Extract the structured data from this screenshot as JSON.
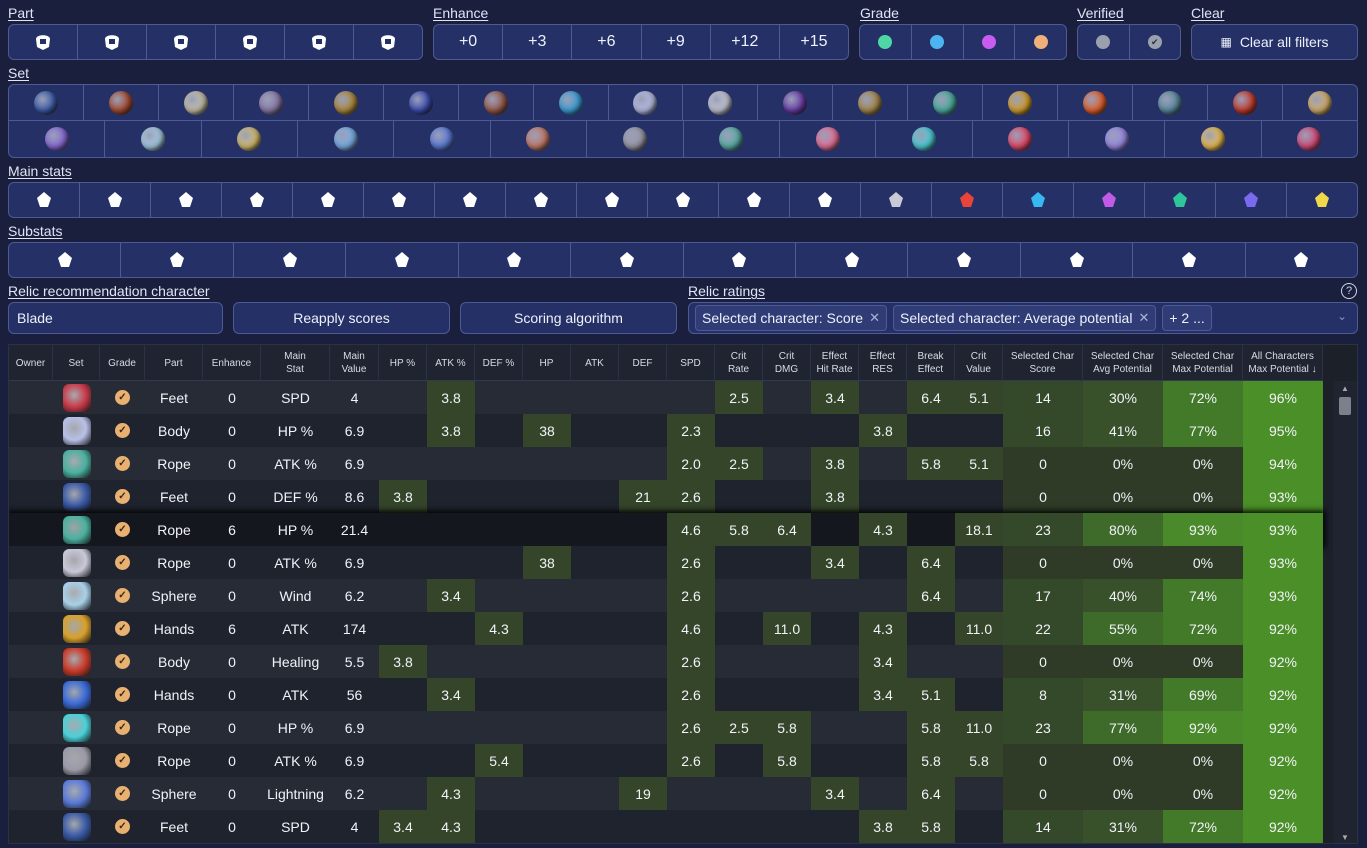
{
  "labels": {
    "part": "Part",
    "enhance": "Enhance",
    "grade": "Grade",
    "verified": "Verified",
    "clear": "Clear",
    "set": "Set",
    "main_stats": "Main stats",
    "substats": "Substats",
    "recommendation": "Relic recommendation character",
    "ratings": "Relic ratings"
  },
  "part_icons": [
    "helmet-icon",
    "gloves-icon",
    "body-armor-icon",
    "boots-icon",
    "orb-ring-icon",
    "rope-icon"
  ],
  "enhance_options": [
    "+0",
    "+3",
    "+6",
    "+9",
    "+12",
    "+15"
  ],
  "grade_colors": [
    "#4fd6a6",
    "#4cb4f0",
    "#c95cf0",
    "#f0b07a"
  ],
  "verified_colors": [
    "#9aa0ad",
    "#9aa0ad"
  ],
  "clear_label": "Clear all filters",
  "set_row1_colors": [
    "#3a5aa8",
    "#a84a2e",
    "#c9c2a8",
    "#8a7aa8",
    "#b08a3a",
    "#3a4ab0",
    "#9a5a4a",
    "#3aa0d8",
    "#b8c0e8",
    "#c8c8d8",
    "#6a3aa8",
    "#a88a4a",
    "#4ab0a0",
    "#d8a02a",
    "#e8602a",
    "#5a8aa0",
    "#c83a2a",
    "#d8b06a"
  ],
  "set_row2_colors": [
    "#8a6ad8",
    "#a8d0e8",
    "#d8c070",
    "#7ab0e8",
    "#5a7ad8",
    "#c87a6a",
    "#9a9aa8",
    "#5ab0a8",
    "#e8709a",
    "#4ad0d8",
    "#e84a6a",
    "#9a8ae8",
    "#f0c050",
    "#d84a7a"
  ],
  "main_stat_icons": [
    "hp-pct-icon",
    "atk-pct-icon",
    "def-pct-icon",
    "hp-icon",
    "atk-icon",
    "crit-rate-icon",
    "crit-dmg-icon",
    "outgoing-healing-icon",
    "effect-hit-icon",
    "spd-icon",
    "healing-icon",
    "break-effect-icon",
    "energy-regen-icon",
    "fire-icon",
    "ice-icon",
    "lightning-icon",
    "wind-icon",
    "quantum-icon",
    "imaginary-icon"
  ],
  "main_stat_colors": [
    "#fff",
    "#fff",
    "#fff",
    "#fff",
    "#fff",
    "#fff",
    "#fff",
    "#fff",
    "#fff",
    "#fff",
    "#fff",
    "#fff",
    "#c8cbd6",
    "#e8443a",
    "#38b8f0",
    "#c25ae8",
    "#2fc49a",
    "#7a6af0",
    "#f0d84a"
  ],
  "substat_icons": [
    "hp-pct-icon",
    "atk-pct-icon",
    "def-pct-icon",
    "hp-icon",
    "atk-icon",
    "def-icon",
    "crit-rate-icon",
    "crit-dmg-icon",
    "effect-hit-icon",
    "effect-res-icon",
    "break-effect-icon",
    "spd-icon"
  ],
  "character": "Blade",
  "reapply_label": "Reapply scores",
  "scoring_label": "Scoring algorithm",
  "rating_chips": [
    "Selected character: Score",
    "Selected character: Average potential"
  ],
  "rating_more": "+ 2 ...",
  "help_glyph": "?",
  "columns": [
    "Owner",
    "Set",
    "Grade",
    "Part",
    "Enhance",
    "Main\nStat",
    "Main\nValue",
    "HP %",
    "ATK %",
    "DEF %",
    "HP",
    "ATK",
    "DEF",
    "SPD",
    "Crit\nRate",
    "Crit\nDMG",
    "Effect\nHit Rate",
    "Effect\nRES",
    "Break\nEffect",
    "Crit\nValue",
    "Selected Char\nScore",
    "Selected Char\nAvg Potential",
    "Selected Char\nMax Potential",
    "All Characters\nMax Potential ↓"
  ],
  "rows": [
    {
      "set": "#c83a4a",
      "part": "Feet",
      "enh": "0",
      "ms": "SPD",
      "mv": "4",
      "s": [
        "",
        "3.8",
        "",
        "",
        "",
        "",
        "",
        "2.5",
        "",
        "3.4",
        "",
        "6.4"
      ],
      "cv": "5.1",
      "sc": "14",
      "avg": "30%",
      "max": "72%",
      "all": "96%"
    },
    {
      "set": "#b8c0e8",
      "part": "Body",
      "enh": "0",
      "ms": "HP %",
      "mv": "6.9",
      "s": [
        "",
        "3.8",
        "",
        "38",
        "",
        "",
        "2.3",
        "",
        "",
        "",
        "3.8",
        ""
      ],
      "cv": "",
      "sc": "16",
      "avg": "41%",
      "max": "77%",
      "all": "95%"
    },
    {
      "set": "#4ab0a0",
      "part": "Rope",
      "enh": "0",
      "ms": "ATK %",
      "mv": "6.9",
      "s": [
        "",
        "",
        "",
        "",
        "",
        "",
        "2.0",
        "2.5",
        "",
        "3.8",
        "",
        "5.8"
      ],
      "cv": "5.1",
      "sc": "0",
      "avg": "0%",
      "max": "0%",
      "all": "94%"
    },
    {
      "set": "#3a5aa8",
      "part": "Feet",
      "enh": "0",
      "ms": "DEF %",
      "mv": "8.6",
      "s": [
        "3.8",
        "",
        "",
        "",
        "",
        "21",
        "2.6",
        "",
        "",
        "3.8",
        "",
        ""
      ],
      "cv": "",
      "sc": "0",
      "avg": "0%",
      "max": "0%",
      "all": "93%"
    },
    {
      "set": "#4ab0a0",
      "part": "Rope",
      "enh": "6",
      "ms": "HP %",
      "mv": "21.4",
      "s": [
        "",
        "",
        "",
        "",
        "",
        "",
        "4.6",
        "5.8",
        "6.4",
        "",
        "4.3",
        ""
      ],
      "cv": "18.1",
      "sc": "23",
      "avg": "80%",
      "max": "93%",
      "all": "93%"
    },
    {
      "set": "#c8c8d8",
      "part": "Rope",
      "enh": "0",
      "ms": "ATK %",
      "mv": "6.9",
      "s": [
        "",
        "",
        "",
        "38",
        "",
        "",
        "2.6",
        "",
        "",
        "3.4",
        "",
        "6.4"
      ],
      "cv": "",
      "sc": "0",
      "avg": "0%",
      "max": "0%",
      "all": "93%"
    },
    {
      "set": "#a8d0e8",
      "part": "Sphere",
      "enh": "0",
      "ms": "Wind",
      "mv": "6.2",
      "s": [
        "",
        "3.4",
        "",
        "",
        "",
        "",
        "2.6",
        "",
        "",
        "",
        "",
        "6.4"
      ],
      "cv": "",
      "sc": "17",
      "avg": "40%",
      "max": "74%",
      "all": "93%"
    },
    {
      "set": "#d8a02a",
      "part": "Hands",
      "enh": "6",
      "ms": "ATK",
      "mv": "174",
      "s": [
        "",
        "",
        "4.3",
        "",
        "",
        "",
        "4.6",
        "",
        "11.0",
        "",
        "4.3",
        ""
      ],
      "cv": "11.0",
      "sc": "22",
      "avg": "55%",
      "max": "72%",
      "all": "92%"
    },
    {
      "set": "#c83a2a",
      "part": "Body",
      "enh": "0",
      "ms": "Healing",
      "mv": "5.5",
      "s": [
        "3.8",
        "",
        "",
        "",
        "",
        "",
        "2.6",
        "",
        "",
        "",
        "3.4",
        ""
      ],
      "cv": "",
      "sc": "0",
      "avg": "0%",
      "max": "0%",
      "all": "92%"
    },
    {
      "set": "#3a6ad8",
      "part": "Hands",
      "enh": "0",
      "ms": "ATK",
      "mv": "56",
      "s": [
        "",
        "3.4",
        "",
        "",
        "",
        "",
        "2.6",
        "",
        "",
        "",
        "3.4",
        "5.1"
      ],
      "cv": "",
      "sc": "8",
      "avg": "31%",
      "max": "69%",
      "all": "92%"
    },
    {
      "set": "#4ad0d8",
      "part": "Rope",
      "enh": "0",
      "ms": "HP %",
      "mv": "6.9",
      "s": [
        "",
        "",
        "",
        "",
        "",
        "",
        "2.6",
        "2.5",
        "5.8",
        "",
        "",
        "5.8"
      ],
      "cv": "11.0",
      "sc": "23",
      "avg": "77%",
      "max": "92%",
      "all": "92%"
    },
    {
      "set": "#9a9aa8",
      "part": "Rope",
      "enh": "0",
      "ms": "ATK %",
      "mv": "6.9",
      "s": [
        "",
        "",
        "5.4",
        "",
        "",
        "",
        "2.6",
        "",
        "5.8",
        "",
        "",
        "5.8"
      ],
      "cv": "5.8",
      "sc": "0",
      "avg": "0%",
      "max": "0%",
      "all": "92%"
    },
    {
      "set": "#5a7ad8",
      "part": "Sphere",
      "enh": "0",
      "ms": "Lightning",
      "mv": "6.2",
      "s": [
        "",
        "4.3",
        "",
        "",
        "",
        "19",
        "",
        "",
        "",
        "3.4",
        "",
        "6.4"
      ],
      "cv": "",
      "sc": "0",
      "avg": "0%",
      "max": "0%",
      "all": "92%"
    },
    {
      "set": "#3a5aa8",
      "part": "Feet",
      "enh": "0",
      "ms": "SPD",
      "mv": "4",
      "s": [
        "3.4",
        "4.3",
        "",
        "",
        "",
        "",
        "",
        "",
        "",
        "",
        "3.8",
        "5.8"
      ],
      "cv": "",
      "sc": "14",
      "avg": "31%",
      "max": "72%",
      "all": "92%"
    }
  ]
}
